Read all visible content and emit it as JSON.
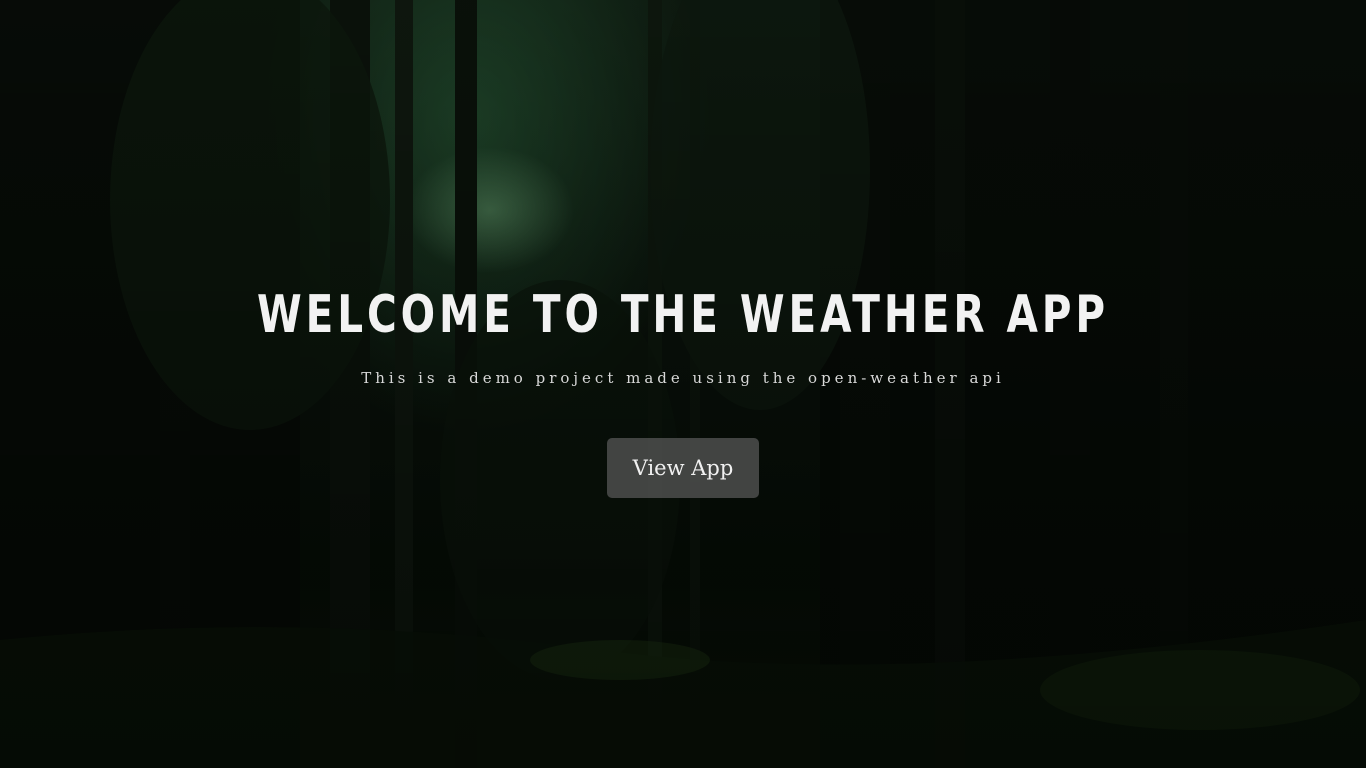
{
  "hero": {
    "title": "WELCOME TO THE WEATHER APP",
    "subtitle": "This is a demo project made using the open-weather api",
    "cta_label": "View App"
  },
  "colors": {
    "title": "#f2f2f2",
    "subtitle": "#d8d8d8",
    "button_bg": "#5a5a5a",
    "background": "#0a130b"
  }
}
